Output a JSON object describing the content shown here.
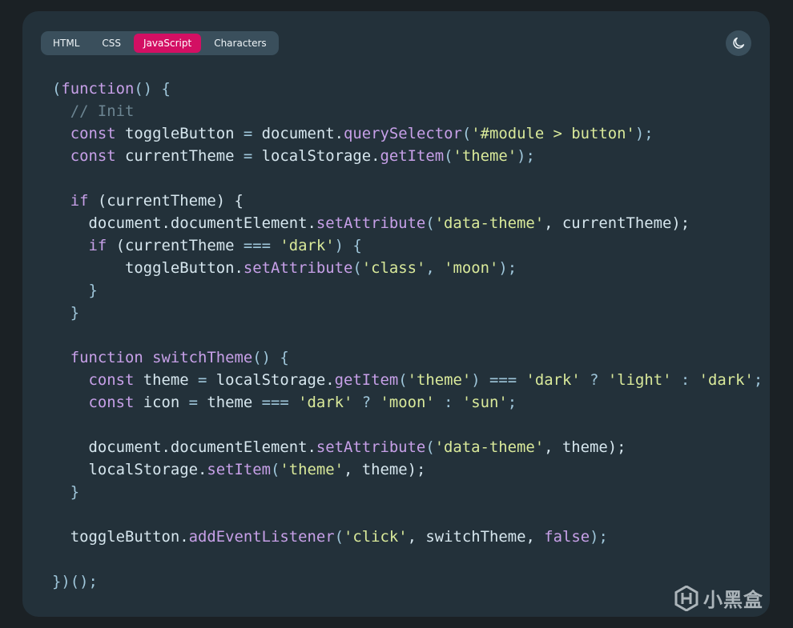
{
  "tabs": [
    {
      "label": "HTML",
      "active": false
    },
    {
      "label": "CSS",
      "active": false
    },
    {
      "label": "JavaScript",
      "active": true
    },
    {
      "label": "Characters",
      "active": false
    }
  ],
  "theme_toggle": {
    "icon": "moon-icon"
  },
  "colors": {
    "active_tab": "#d30f63",
    "keyword": "#c7a0e8",
    "string": "#d9e99a",
    "comment": "#6c8592",
    "identifier": "#d6e6ee",
    "background": "#23313a"
  },
  "code": {
    "language": "JavaScript",
    "lines": [
      [
        [
          "(",
          "pu"
        ],
        [
          "function",
          "kw"
        ],
        [
          "() {",
          "pu"
        ]
      ],
      [
        [
          "  ",
          "id"
        ],
        [
          "// Init",
          "cm"
        ]
      ],
      [
        [
          "  ",
          "id"
        ],
        [
          "const",
          "kw"
        ],
        [
          " toggleButton ",
          "id"
        ],
        [
          "=",
          "op"
        ],
        [
          " document.",
          "id"
        ],
        [
          "querySelector",
          "fn"
        ],
        [
          "(",
          "pu"
        ],
        [
          "'#module > button'",
          "str"
        ],
        [
          ");",
          "pu"
        ]
      ],
      [
        [
          "  ",
          "id"
        ],
        [
          "const",
          "kw"
        ],
        [
          " currentTheme ",
          "id"
        ],
        [
          "=",
          "op"
        ],
        [
          " localStorage.",
          "id"
        ],
        [
          "getItem",
          "fn"
        ],
        [
          "(",
          "pu"
        ],
        [
          "'theme'",
          "str"
        ],
        [
          ");",
          "pu"
        ]
      ],
      [],
      [
        [
          "  ",
          "id"
        ],
        [
          "if",
          "kw"
        ],
        [
          " (currentTheme) {",
          "id"
        ]
      ],
      [
        [
          "    document.documentElement.",
          "id"
        ],
        [
          "setAttribute",
          "fn"
        ],
        [
          "(",
          "pu"
        ],
        [
          "'data-theme'",
          "str"
        ],
        [
          ", currentTheme);",
          "id"
        ]
      ],
      [
        [
          "    ",
          "id"
        ],
        [
          "if",
          "kw"
        ],
        [
          " (currentTheme ",
          "id"
        ],
        [
          "===",
          "op"
        ],
        [
          " ",
          "id"
        ],
        [
          "'dark'",
          "str"
        ],
        [
          ") {",
          "pu"
        ]
      ],
      [
        [
          "        toggleButton.",
          "id"
        ],
        [
          "setAttribute",
          "fn"
        ],
        [
          "(",
          "pu"
        ],
        [
          "'class'",
          "str"
        ],
        [
          ", ",
          "pu"
        ],
        [
          "'moon'",
          "str"
        ],
        [
          ");",
          "pu"
        ]
      ],
      [
        [
          "    }",
          "pu"
        ]
      ],
      [
        [
          "  }",
          "pu"
        ]
      ],
      [],
      [
        [
          "  ",
          "id"
        ],
        [
          "function",
          "kw"
        ],
        [
          " ",
          "id"
        ],
        [
          "switchTheme",
          "fn"
        ],
        [
          "() {",
          "pu"
        ]
      ],
      [
        [
          "    ",
          "id"
        ],
        [
          "const",
          "kw"
        ],
        [
          " theme ",
          "id"
        ],
        [
          "=",
          "op"
        ],
        [
          " localStorage.",
          "id"
        ],
        [
          "getItem",
          "fn"
        ],
        [
          "(",
          "pu"
        ],
        [
          "'theme'",
          "str"
        ],
        [
          ") ",
          "pu"
        ],
        [
          "===",
          "op"
        ],
        [
          " ",
          "id"
        ],
        [
          "'dark'",
          "str"
        ],
        [
          " ? ",
          "op"
        ],
        [
          "'light'",
          "str"
        ],
        [
          " : ",
          "op"
        ],
        [
          "'dark'",
          "str"
        ],
        [
          ";",
          "pu"
        ]
      ],
      [
        [
          "    ",
          "id"
        ],
        [
          "const",
          "kw"
        ],
        [
          " icon ",
          "id"
        ],
        [
          "=",
          "op"
        ],
        [
          " theme ",
          "id"
        ],
        [
          "===",
          "op"
        ],
        [
          " ",
          "id"
        ],
        [
          "'dark'",
          "str"
        ],
        [
          " ? ",
          "op"
        ],
        [
          "'moon'",
          "str"
        ],
        [
          " : ",
          "op"
        ],
        [
          "'sun'",
          "str"
        ],
        [
          ";",
          "pu"
        ]
      ],
      [],
      [
        [
          "    document.documentElement.",
          "id"
        ],
        [
          "setAttribute",
          "fn"
        ],
        [
          "(",
          "pu"
        ],
        [
          "'data-theme'",
          "str"
        ],
        [
          ", theme);",
          "id"
        ]
      ],
      [
        [
          "    localStorage.",
          "id"
        ],
        [
          "setItem",
          "fn"
        ],
        [
          "(",
          "pu"
        ],
        [
          "'theme'",
          "str"
        ],
        [
          ", theme);",
          "id"
        ]
      ],
      [
        [
          "  }",
          "pu"
        ]
      ],
      [],
      [
        [
          "  toggleButton.",
          "id"
        ],
        [
          "addEventListener",
          "fn"
        ],
        [
          "(",
          "pu"
        ],
        [
          "'click'",
          "str"
        ],
        [
          ", switchTheme, ",
          "id"
        ],
        [
          "false",
          "kw"
        ],
        [
          ");",
          "pu"
        ]
      ],
      [],
      [
        [
          "})();",
          "pu"
        ]
      ]
    ]
  },
  "watermark": {
    "text": "小黑盒",
    "icon": "xiaoheihe-logo-icon"
  }
}
